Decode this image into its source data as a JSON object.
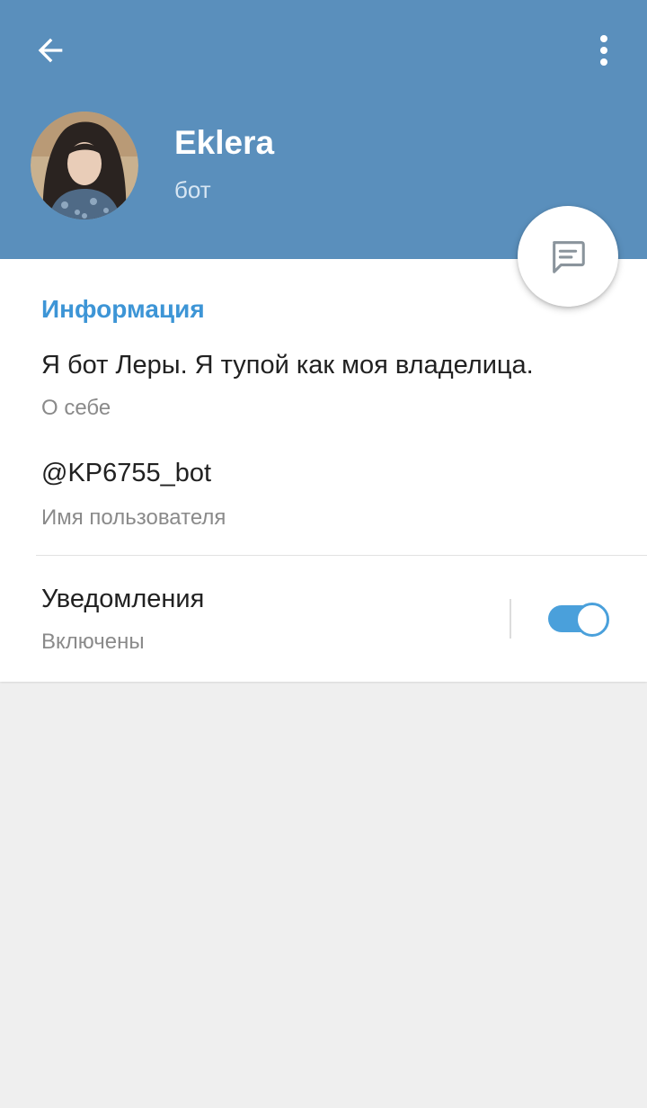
{
  "header": {
    "back_icon": "arrow-left-icon",
    "menu_icon": "more-vertical-icon",
    "name": "Eklera",
    "status": "бот",
    "color": "#5a8fbc"
  },
  "fab": {
    "icon": "message-icon"
  },
  "info": {
    "section_title": "Информация",
    "bio": {
      "value": "Я бот Леры. Я тупой как моя владелица.",
      "label": "О себе"
    },
    "username": {
      "value": "@KP6755_bot",
      "label": "Имя пользователя"
    },
    "notifications": {
      "title": "Уведомления",
      "state": "Включены",
      "enabled": true
    }
  },
  "colors": {
    "accent": "#3d95d6",
    "toggle_track": "#4aa0db",
    "background": "#efefef"
  }
}
